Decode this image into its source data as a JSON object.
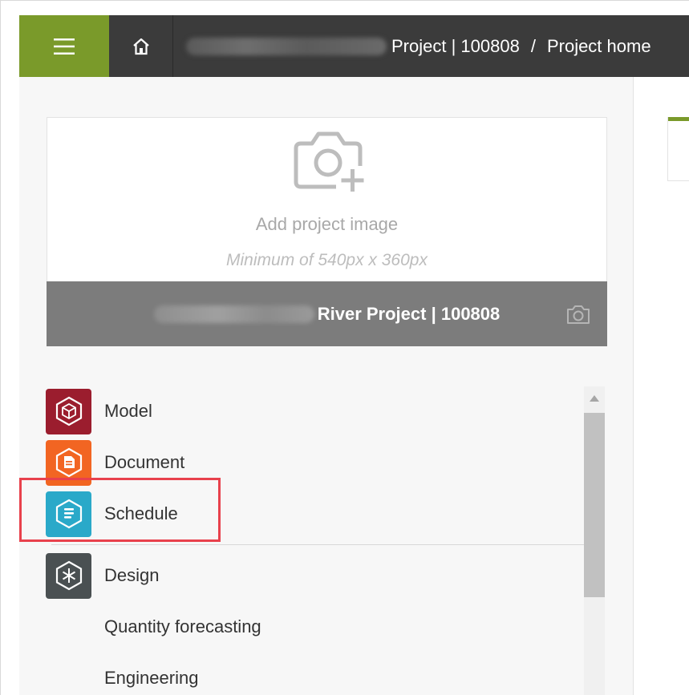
{
  "header": {
    "project_label": "Project | 100808",
    "separator": "/",
    "current_page": "Project home"
  },
  "image_card": {
    "add_label": "Add project image",
    "min_label": "Minimum of 540px x 360px",
    "footer_title": "River Project | 100808"
  },
  "modules": [
    {
      "label": "Model",
      "color": "#9b1d2e",
      "icon": "cube-icon"
    },
    {
      "label": "Document",
      "color": "#f26522",
      "icon": "document-icon"
    },
    {
      "label": "Schedule",
      "color": "#2aa9c9",
      "icon": "schedule-icon"
    },
    {
      "label": "Design",
      "color": "#4a5052",
      "icon": "design-icon"
    },
    {
      "label": "Quantity forecasting"
    },
    {
      "label": "Engineering"
    }
  ],
  "colors": {
    "brand_green": "#7a9a2a",
    "topbar_dark": "#3b3b3b",
    "highlight_red": "#e8414c"
  }
}
